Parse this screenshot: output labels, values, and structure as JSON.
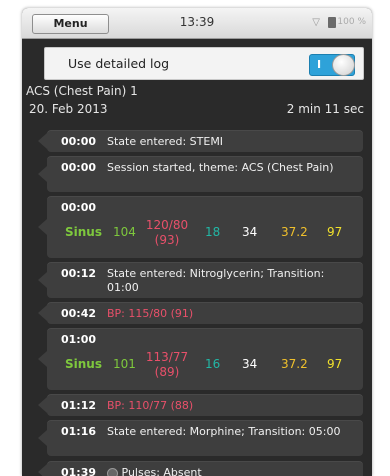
{
  "status": {
    "menu_label": "Menu",
    "time": "13:39",
    "battery": "100 %",
    "wifi_icon": "wifi-icon"
  },
  "toggle": {
    "label": "Use detailed log",
    "state": "I"
  },
  "session": {
    "title": "ACS (Chest Pain) 1",
    "date": "20. Feb 2013",
    "duration": "2 min 11 sec"
  },
  "log": [
    {
      "time": "00:00",
      "text": "State entered: STEMI"
    },
    {
      "time": "00:00",
      "text": "Session started, theme: ACS (Chest Pain)"
    },
    {
      "time": "00:00",
      "vitals": {
        "rhythm": "Sinus",
        "hr": "104",
        "bp": "120/80",
        "map": "(93)",
        "rr": "18",
        "etco2": "34",
        "temp": "37.2",
        "spo2": "97"
      }
    },
    {
      "time": "00:12",
      "text": "State entered: Nitroglycerin; Transition: 01:00"
    },
    {
      "time": "00:42",
      "text": "BP: 115/80 (91)"
    },
    {
      "time": "01:00",
      "vitals": {
        "rhythm": "Sinus",
        "hr": "101",
        "bp": "113/77",
        "map": "(89)",
        "rr": "16",
        "etco2": "34",
        "temp": "37.2",
        "spo2": "97"
      }
    },
    {
      "time": "01:12",
      "text": "BP: 110/77 (88)"
    },
    {
      "time": "01:16",
      "text": "State entered: Morphine; Transition: 05:00"
    },
    {
      "time": "01:39",
      "text": "Pulses: Absent"
    }
  ],
  "colors": {
    "rhythm": "#7ec83d",
    "bp": "#e8506a",
    "rr": "#22b7a5",
    "temp": "#f0c02c",
    "spo2": "#f0e02c",
    "switch": "#2ea2d9"
  }
}
